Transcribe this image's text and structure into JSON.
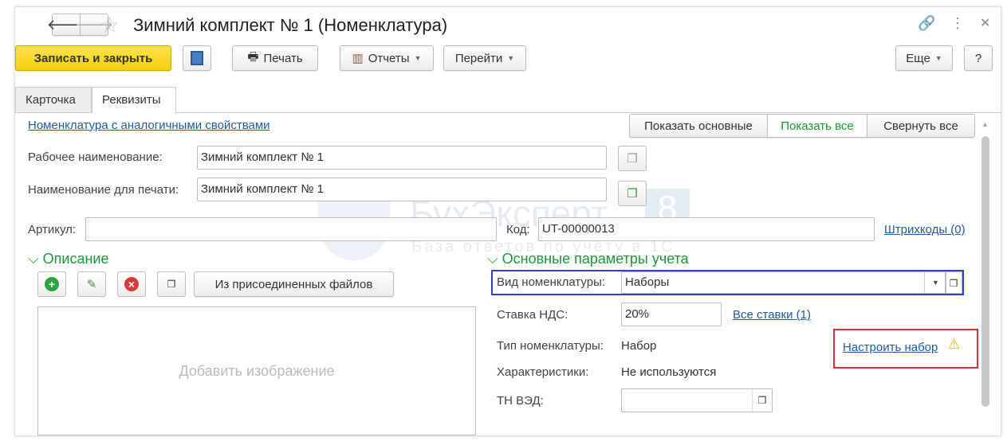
{
  "title": "Зимний комплект № 1 (Номенклатура)",
  "toolbar": {
    "save_close": "Записать и закрыть",
    "print": "Печать",
    "reports": "Отчеты",
    "goto": "Перейти",
    "more": "Еще",
    "help": "?"
  },
  "tabs": [
    {
      "label": "Карточка"
    },
    {
      "label": "Реквизиты"
    }
  ],
  "similar_link": "Номенклатура с аналогичными свойствами",
  "view_buttons": {
    "basic": "Показать основные",
    "all": "Показать все",
    "collapse": "Свернуть все"
  },
  "fields": {
    "work_name_label": "Рабочее наименование:",
    "work_name": "Зимний комплект № 1",
    "print_name_label": "Наименование для печати:",
    "print_name": "Зимний комплект № 1",
    "article_label": "Артикул:",
    "article": "",
    "code_label": "Код:",
    "code": "UT-00000013",
    "barcodes": "Штрихкоды (0)"
  },
  "description": {
    "title": "Описание",
    "attached_files": "Из присоединенных файлов",
    "add_image": "Добавить изображение"
  },
  "accounting": {
    "title": "Основные параметры учета",
    "kind_label": "Вид номенклатуры:",
    "kind": "Наборы",
    "vat_label": "Ставка НДС:",
    "vat": "20%",
    "all_rates": "Все ставки (1)",
    "type_label": "Тип номенклатуры:",
    "type": "Набор",
    "setup_set": "Настроить набор",
    "chars_label": "Характеристики:",
    "chars": "Не используются",
    "tnved_label": "ТН ВЭД:",
    "tnved": ""
  },
  "watermark": {
    "brand": "БухЭксперт",
    "num": "8",
    "sub": "База ответов по учёту в 1С"
  },
  "colors": {
    "accent_green": "#1a9a3a",
    "link": "#1f5ea8",
    "highlight_blue": "#2b3fd6",
    "highlight_red": "#e0303a",
    "yellow": "#f3cf10"
  }
}
